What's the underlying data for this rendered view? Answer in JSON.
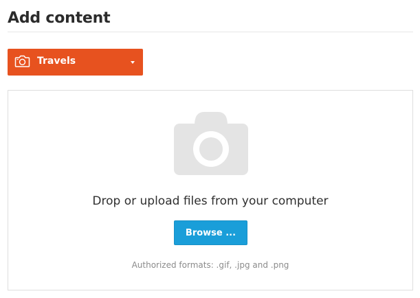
{
  "header": {
    "title": "Add content"
  },
  "category_select": {
    "selected": "Travels",
    "icon": "camera-icon",
    "color": "#e7521f"
  },
  "upload": {
    "placeholder_icon": "camera-placeholder-icon",
    "drop_text": "Drop or upload files from your computer",
    "browse_label": "Browse ...",
    "browse_color": "#1a9ed9",
    "formats_text": "Authorized formats: .gif, .jpg and .png"
  }
}
